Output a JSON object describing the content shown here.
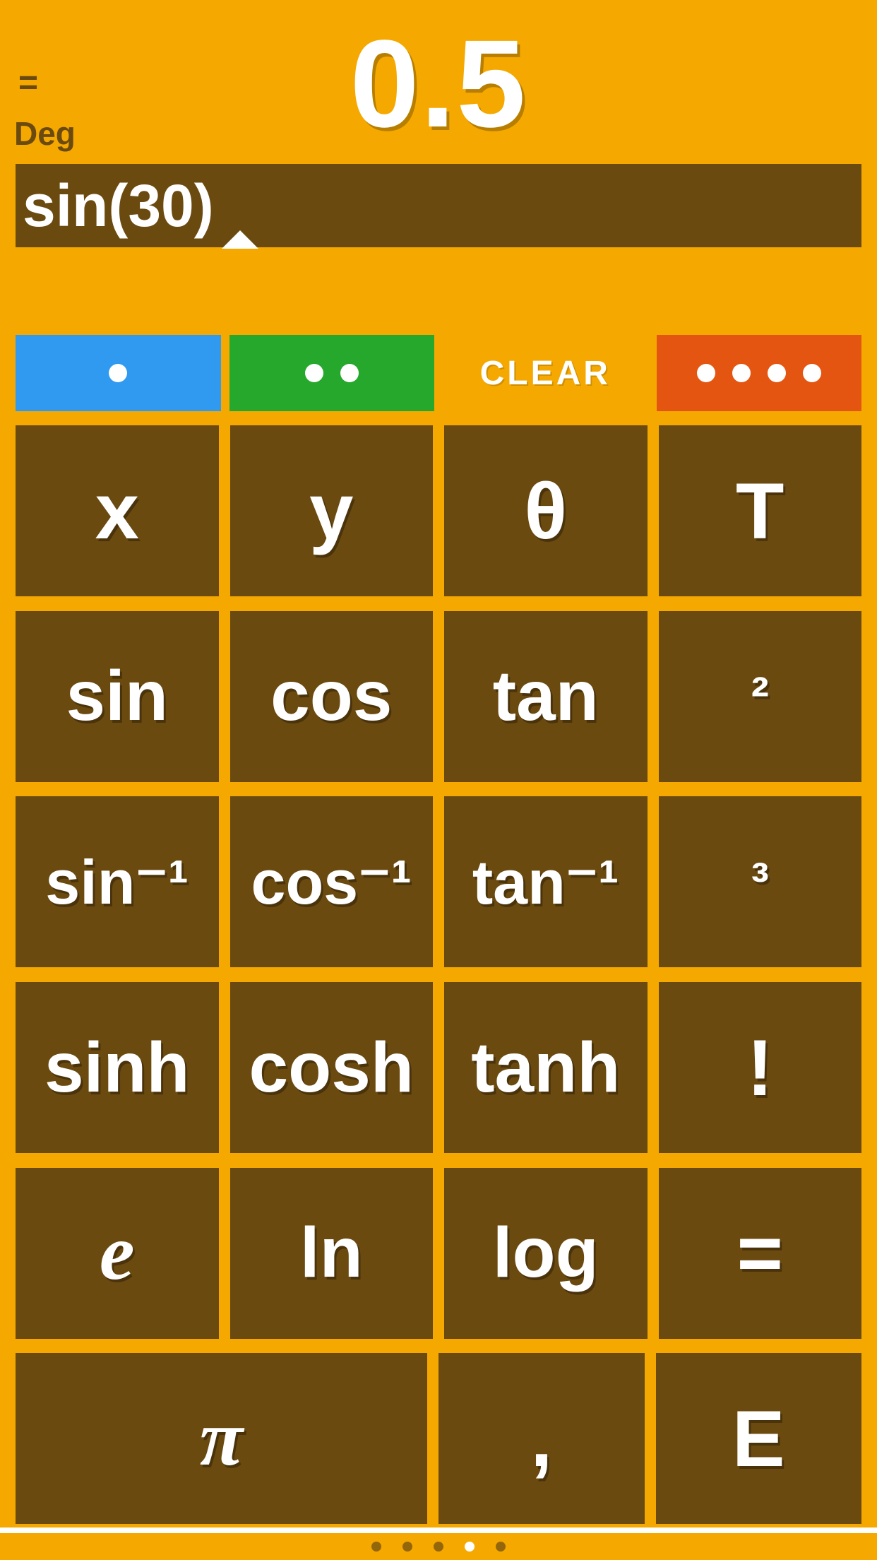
{
  "display": {
    "equals": "=",
    "mode": "Deg",
    "result": "0.5"
  },
  "expression": "sin(30)",
  "actions": {
    "clear_label": "CLEAR"
  },
  "keys": {
    "r1": [
      "x",
      "y",
      "θ",
      "T"
    ],
    "r2": [
      "sin",
      "cos",
      "tan",
      "²"
    ],
    "r3": [
      "sin⁻¹",
      "cos⁻¹",
      "tan⁻¹",
      "³"
    ],
    "r4": [
      "sinh",
      "cosh",
      "tanh",
      "!"
    ],
    "r5": [
      "e",
      "ln",
      "log",
      "="
    ],
    "r6": [
      "π",
      ",",
      "E"
    ]
  },
  "pager": {
    "count": 5,
    "active": 3
  },
  "colors": {
    "accent": "#f5a800",
    "key": "#6b4a10",
    "blue": "#2f9af0",
    "green": "#26a82c",
    "orange": "#e45512"
  }
}
